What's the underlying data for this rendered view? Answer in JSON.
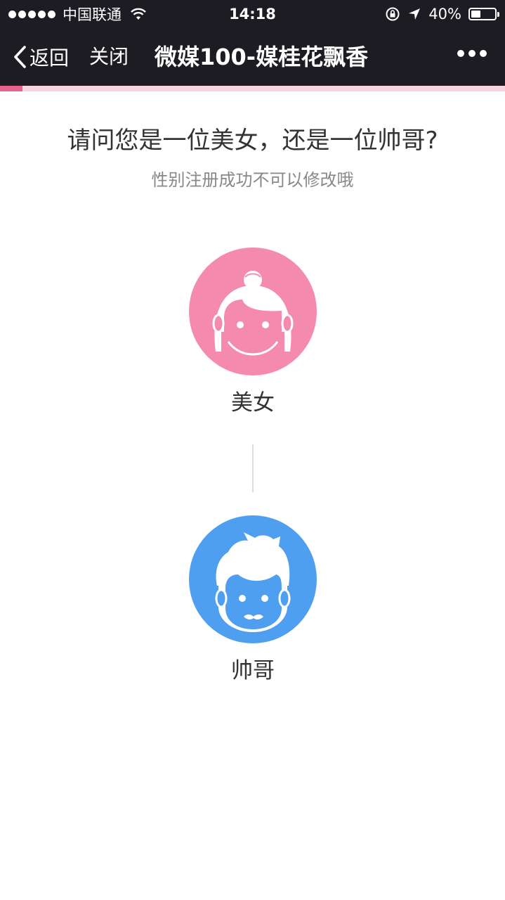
{
  "status_bar": {
    "carrier": "中国联通",
    "time": "14:18",
    "battery_text": "40%",
    "battery_level": 0.4
  },
  "nav": {
    "back_label": "返回",
    "close_label": "关闭",
    "title": "微媒100-媒桂花飘香"
  },
  "progress": {
    "value": 0.045,
    "color": "#e8628f",
    "track_color": "#f7d3e0"
  },
  "content": {
    "question": "请问您是一位美女，还是一位帅哥?",
    "hint": "性别注册成功不可以修改哦",
    "options": [
      {
        "label": "美女",
        "color": "#f48aae",
        "icon": "female-avatar-icon"
      },
      {
        "label": "帅哥",
        "color": "#4f9ff0",
        "icon": "male-avatar-icon"
      }
    ]
  }
}
